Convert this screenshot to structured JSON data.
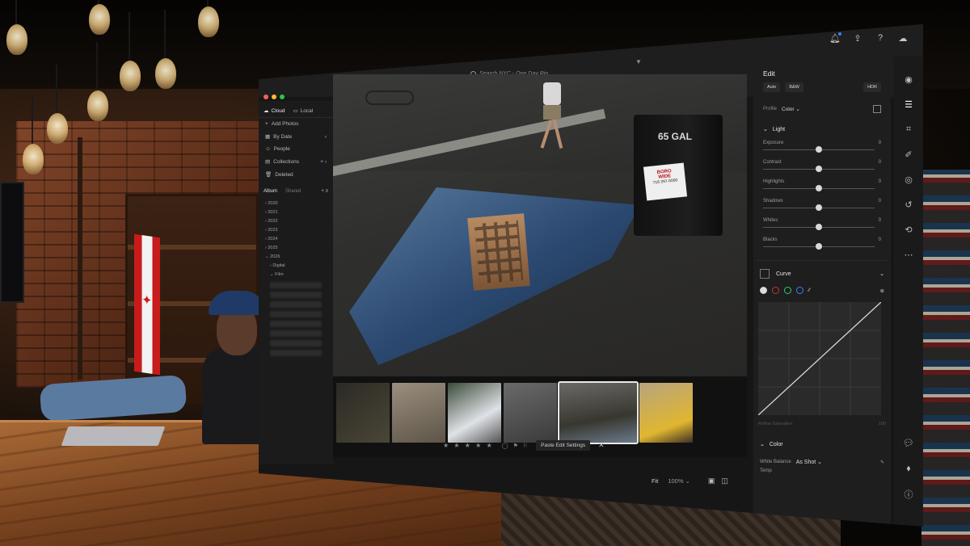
{
  "app": {
    "search_placeholder": "Search NYC - One Day Rip",
    "top_icons": [
      "bell-icon",
      "share-icon",
      "help-icon",
      "cloud-icon"
    ]
  },
  "sidebar": {
    "tabs": [
      {
        "label": "Cloud",
        "active": true
      },
      {
        "label": "Local",
        "active": false
      }
    ],
    "add_photos": "Add Photos",
    "items": [
      {
        "label": "By Date"
      },
      {
        "label": "People"
      },
      {
        "label": "Collections"
      },
      {
        "label": "Deleted"
      }
    ],
    "albums_tabs": [
      "Album",
      "Shared"
    ],
    "years": [
      "2020",
      "2021",
      "2022",
      "2023",
      "2024",
      "2025",
      "2026"
    ],
    "subfolders": [
      "Digital",
      "Film"
    ]
  },
  "photo": {
    "bin_label": "65 GAL",
    "sign_line1": "BORO",
    "sign_line2": "WIDE",
    "sign_line3": "718 397-5000"
  },
  "filmstrip": {
    "selected_index": 4,
    "count": 6
  },
  "bottombar": {
    "stars": "★ ★ ★ ★ ★",
    "paste_label": "Paste Edit Settings",
    "close_label": "✕",
    "fit_label": "Fit",
    "zoom_label": "100%"
  },
  "edit": {
    "title": "Edit",
    "auto_label": "Auto",
    "bw_label": "B&W",
    "hdr_label": "HDR",
    "profile_label": "Profile",
    "profile_value": "Color",
    "light_title": "Light",
    "sliders": [
      {
        "label": "Exposure",
        "value": "0",
        "pos": 0.5
      },
      {
        "label": "Contrast",
        "value": "0",
        "pos": 0.5
      },
      {
        "label": "Highlights",
        "value": "0",
        "pos": 0.5
      },
      {
        "label": "Shadows",
        "value": "0",
        "pos": 0.5
      },
      {
        "label": "Whites",
        "value": "0",
        "pos": 0.5
      },
      {
        "label": "Blacks",
        "value": "0",
        "pos": 0.5
      }
    ],
    "curve_title": "Curve",
    "refine_label": "Refine Saturation",
    "refine_value": "100",
    "color_title": "Color",
    "wb_label": "White Balance",
    "wb_value": "As Shot",
    "temp_label": "Temp"
  },
  "colors": {
    "accent": "#3b82f6",
    "panel": "#1e1e1f",
    "curve_red": "#c0392b",
    "curve_green": "#2ecc71",
    "curve_blue": "#3b82f6"
  }
}
